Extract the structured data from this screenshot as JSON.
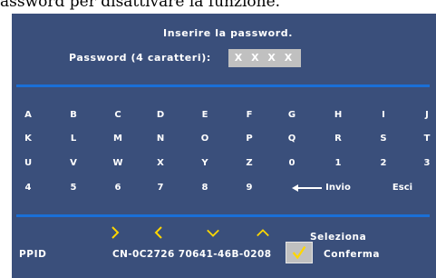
{
  "caption": "assword per disattivare la funzione.",
  "dialog": {
    "title": "Inserire la password.",
    "password_label": "Password (4 caratteri):",
    "password_value": "X X X X"
  },
  "keyboard": {
    "rows": [
      [
        "A",
        "B",
        "C",
        "D",
        "E",
        "F",
        "G",
        "H",
        "I",
        "J"
      ],
      [
        "K",
        "L",
        "M",
        "N",
        "O",
        "P",
        "Q",
        "R",
        "S",
        "T"
      ],
      [
        "U",
        "V",
        "W",
        "X",
        "Y",
        "Z",
        "0",
        "1",
        "2",
        "3"
      ],
      [
        "4",
        "5",
        "6",
        "7",
        "8",
        "9"
      ]
    ],
    "backspace_icon": "left-arrow-icon",
    "enter_label": "Invio",
    "exit_label": "Esci"
  },
  "footer": {
    "nav_icons": [
      "right-chevron-icon",
      "left-chevron-icon",
      "down-chevron-icon",
      "up-chevron-icon"
    ],
    "select_label": "Seleziona",
    "ppid_label": "PPID",
    "ppid_value": "CN-0C2726 70641-46B-0208",
    "confirm_label": "Conferma"
  },
  "colors": {
    "panel": "#3a4f7b",
    "rule": "#1a6fd6",
    "nav_arrows": "#ffd700",
    "check": "#ffd700",
    "button_face": "#c0c0c0"
  }
}
